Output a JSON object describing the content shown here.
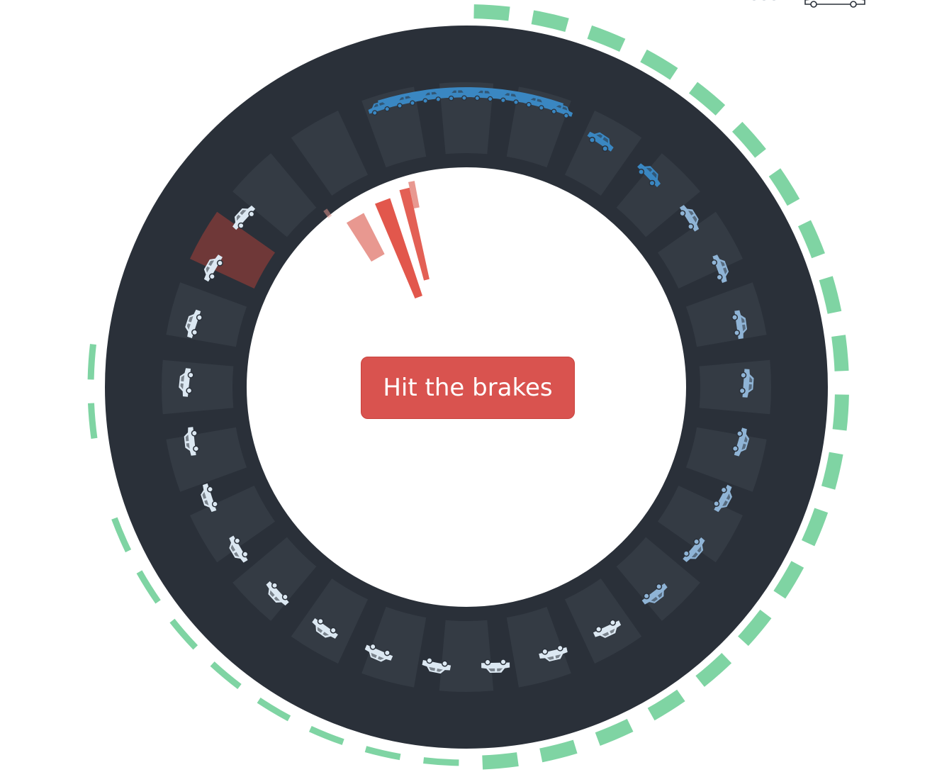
{
  "app": {
    "title": ""
  },
  "controls": {
    "brake_label": "Hit the brakes"
  },
  "colors": {
    "track": "#2a3039",
    "slot": "#343b44",
    "slot_highlight": "#6f3838",
    "outer_ring_dash": "#7fd4a3",
    "brake_button": "#d9534f",
    "fast_car": "#3a87c2",
    "mid_car": "#8fb4d6",
    "slow_car": "#dce8f2",
    "brake_bar": "#e2574c",
    "brake_bar_light": "#e89890"
  },
  "icons": {
    "car": "car-icon",
    "legend": "car-icon"
  },
  "track": {
    "slot_count": 24,
    "highlighted_slot": 20,
    "cars": [
      {
        "id": 1,
        "state": "fast"
      },
      {
        "id": 2,
        "state": "fast"
      },
      {
        "id": 3,
        "state": "mid"
      },
      {
        "id": 4,
        "state": "mid"
      },
      {
        "id": 5,
        "state": "mid"
      },
      {
        "id": 6,
        "state": "mid"
      },
      {
        "id": 7,
        "state": "mid"
      },
      {
        "id": 8,
        "state": "mid"
      },
      {
        "id": 9,
        "state": "mid"
      },
      {
        "id": 10,
        "state": "mid"
      },
      {
        "id": 11,
        "state": "slow"
      },
      {
        "id": 12,
        "state": "slow"
      },
      {
        "id": 13,
        "state": "slow"
      },
      {
        "id": 14,
        "state": "slow"
      },
      {
        "id": 15,
        "state": "slow"
      },
      {
        "id": 16,
        "state": "slow"
      },
      {
        "id": 17,
        "state": "slow"
      },
      {
        "id": 18,
        "state": "slow"
      },
      {
        "id": 19,
        "state": "slow"
      },
      {
        "id": 20,
        "state": "slow"
      },
      {
        "id": 21,
        "state": "slow"
      },
      {
        "id": 22,
        "state": "slow"
      },
      {
        "id": 23,
        "state": "slow"
      },
      {
        "id": 24,
        "state": "slow"
      }
    ],
    "jam_cars": 8,
    "brake_bars": 5
  }
}
